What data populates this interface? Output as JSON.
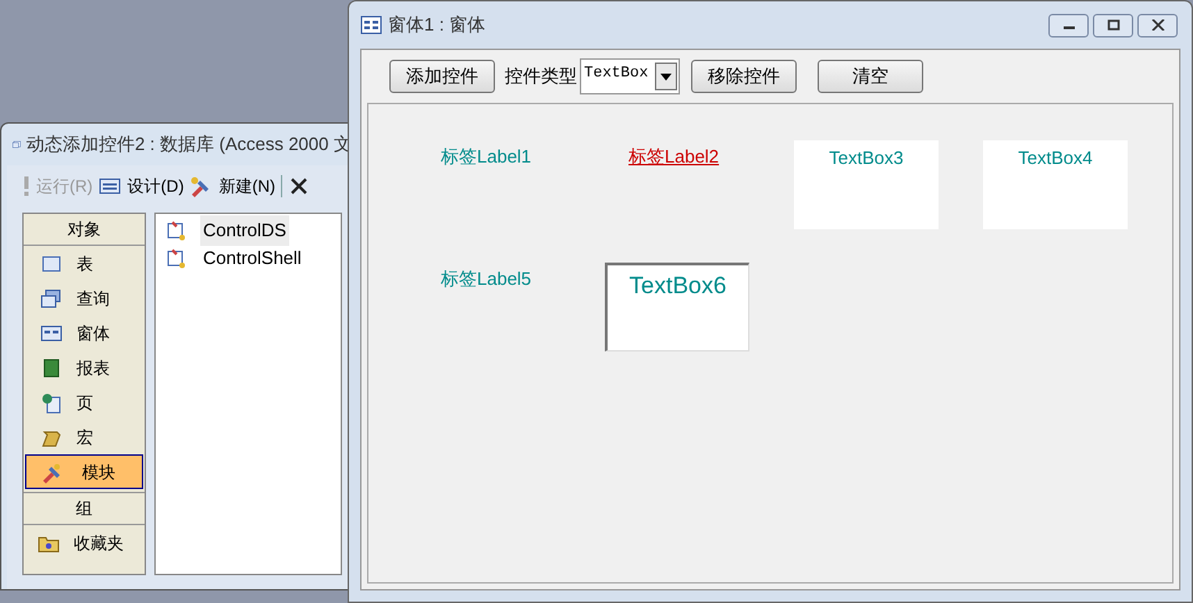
{
  "db_window": {
    "title": "动态添加控件2 : 数据库 (Access 2000 文",
    "toolbar": [
      {
        "kind": "run",
        "label": "运行(R)",
        "disabled": true
      },
      {
        "kind": "design",
        "label": "设计(D)",
        "disabled": false
      },
      {
        "kind": "new",
        "label": "新建(N)",
        "disabled": false
      },
      {
        "kind": "delete",
        "disabled": false
      }
    ],
    "objects_header": "对象",
    "objects": [
      {
        "kind": "table",
        "label": "表",
        "selected": false
      },
      {
        "kind": "query",
        "label": "查询",
        "selected": false
      },
      {
        "kind": "form",
        "label": "窗体",
        "selected": false
      },
      {
        "kind": "report",
        "label": "报表",
        "selected": false
      },
      {
        "kind": "page",
        "label": "页",
        "selected": false
      },
      {
        "kind": "macro",
        "label": "宏",
        "selected": false
      },
      {
        "kind": "module",
        "label": "模块",
        "selected": true
      }
    ],
    "groups_header": "组",
    "groups": [
      {
        "label": "收藏夹"
      }
    ],
    "list": [
      {
        "label": "ControlDS",
        "selected": true
      },
      {
        "label": "ControlShell",
        "selected": false
      }
    ]
  },
  "form_window": {
    "title": "窗体1 : 窗体",
    "add_button": "添加控件",
    "type_label": "控件类型",
    "type_value": "TextBox",
    "remove_button": "移除控件",
    "clear_button": "清空",
    "controls": [
      {
        "kind": "label",
        "text": "标签Label1",
        "color": "#008b8b",
        "underlined": false
      },
      {
        "kind": "label",
        "text": "标签Label2",
        "color": "#cc0000",
        "underlined": true
      },
      {
        "kind": "textbox",
        "text": "TextBox3",
        "color": "#008b8b",
        "sunken": false
      },
      {
        "kind": "textbox",
        "text": "TextBox4",
        "color": "#008b8b",
        "sunken": false
      },
      {
        "kind": "label",
        "text": "标签Label5",
        "color": "#008b8b",
        "underlined": false
      },
      {
        "kind": "textbox",
        "text": "TextBox6",
        "color": "#008b8b",
        "sunken": true
      }
    ]
  }
}
